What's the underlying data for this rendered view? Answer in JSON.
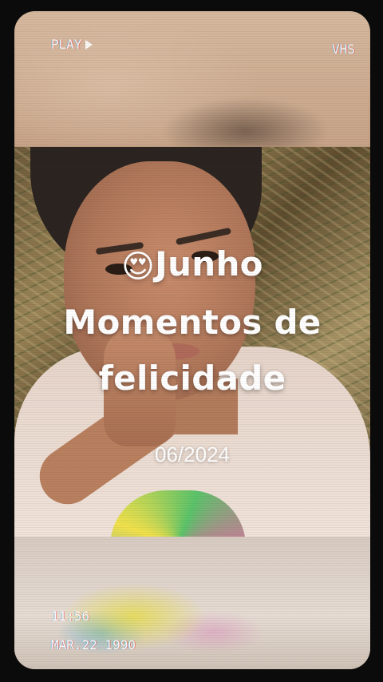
{
  "vhs": {
    "play_label": "PLAY",
    "format_label": "VHS",
    "time": "11:56",
    "date": "MAR.22 1990"
  },
  "post": {
    "emoji": "😍",
    "title_line1": "Junho",
    "title_line2": "Momentos de",
    "title_line3": "felicidade",
    "date": "06/2024"
  },
  "icons": {
    "play": "play-triangle-icon",
    "emoji": "heart-eyes-emoji"
  }
}
